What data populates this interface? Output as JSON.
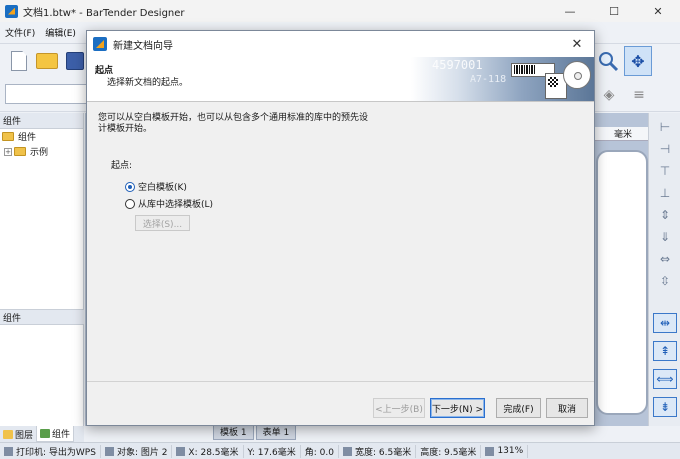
{
  "window": {
    "title": "文档1.btw* - BarTender Designer",
    "buttons": {
      "minimize": "—",
      "maximize": "☐",
      "close": "✕"
    }
  },
  "menu": [
    "文件(F)",
    "编辑(E)"
  ],
  "left_panel": {
    "header": "组件",
    "tree": [
      {
        "label": "组件"
      },
      {
        "label": "示例",
        "expander": "+"
      }
    ],
    "header2": "组件",
    "tabs": [
      "图层",
      "组件"
    ]
  },
  "ruler_unit": "毫米",
  "doc_tabs": [
    "模板 1",
    "表单 1"
  ],
  "statusbar": {
    "printer": "打印机: 导出为WPS",
    "object": "对象: 图片 2",
    "x": "X: 28.5毫米",
    "y": "Y: 17.6毫米",
    "rotate": "角: 0.0",
    "width": "宽度: 6.5毫米",
    "height": "高度: 9.5毫米",
    "zoom": "131%"
  },
  "dialog": {
    "title": "新建文档向导",
    "close": "✕",
    "header_title": "起点",
    "header_subtitle": "选择新文档的起点。",
    "banner_num1": "4597001",
    "banner_num2": "A7-118",
    "intro": "您可以从空白模板开始，也可以从包含多个通用标准的库中的预先设计模板开始。",
    "start_label": "起点:",
    "options": [
      {
        "label": "空白模板(K)",
        "selected": true
      },
      {
        "label": "从库中选择模板(L)",
        "selected": false
      }
    ],
    "select_button": "选择(S)...",
    "buttons": {
      "back": "<上一步(B)",
      "next": "下一步(N) >",
      "finish": "完成(F)",
      "cancel": "取消"
    }
  },
  "colors": {
    "accent": "#1f5fb8",
    "canvas": "#b7c4d8",
    "dialog_bg": "#f0f0f0"
  }
}
